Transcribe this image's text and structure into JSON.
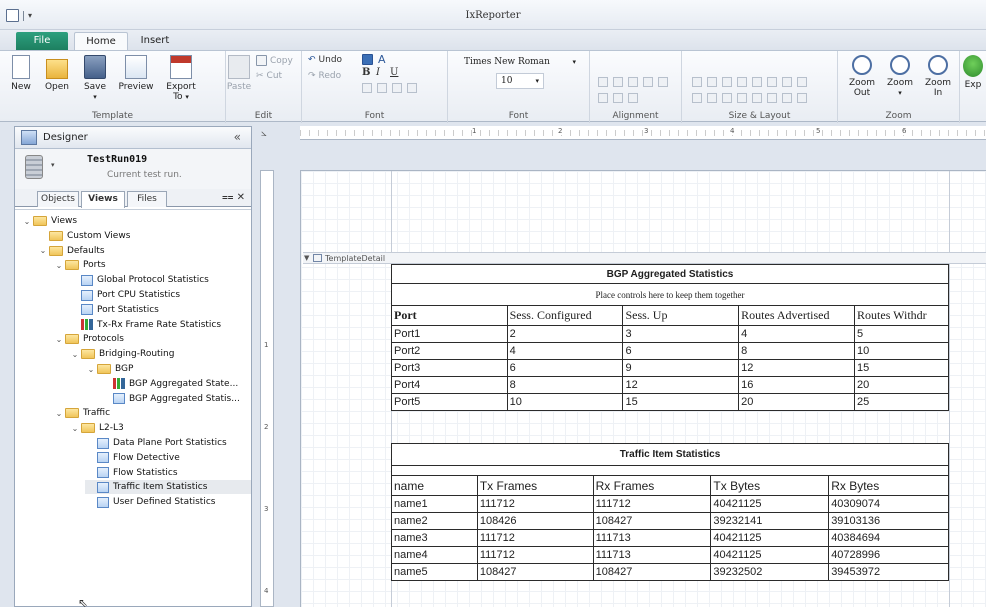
{
  "window": {
    "title": "IxReporter"
  },
  "tabs": {
    "file": "File",
    "home": "Home",
    "insert": "Insert"
  },
  "ribbon": {
    "template": {
      "label": "Template",
      "new": "New",
      "open": "Open",
      "save": "Save",
      "preview": "Preview",
      "export": "Export",
      "export_sub": "To"
    },
    "edit": {
      "label": "Edit",
      "paste": "Paste",
      "copy": "Copy",
      "cut": "Cut",
      "undo": "Undo",
      "redo": "Redo"
    },
    "font_group": {
      "label": "Font",
      "family": "Times New Roman",
      "size": "10"
    },
    "font_label2": "Font",
    "alignment": {
      "label": "Alignment"
    },
    "size_layout": {
      "label": "Size & Layout"
    },
    "zoom": {
      "label": "Zoom",
      "zoom_out": "Zoom Out",
      "zoom": "Zoom",
      "zoom_in": "Zoom In",
      "export_short": "Exp"
    }
  },
  "panel": {
    "title": "Designer",
    "collapse": "«",
    "run_name": "TestRun019",
    "run_sub": "Current test run.",
    "tabs": [
      "Objects",
      "Views",
      "Files"
    ],
    "tree": [
      {
        "label": "Views",
        "depth": 0,
        "type": "folder",
        "chev": "⌄"
      },
      {
        "label": "Custom Views",
        "depth": 1,
        "type": "folder",
        "chev": ""
      },
      {
        "label": "Defaults",
        "depth": 1,
        "type": "folder",
        "chev": "⌄"
      },
      {
        "label": "Ports",
        "depth": 2,
        "type": "folder",
        "chev": "⌄"
      },
      {
        "label": "Global Protocol Statistics",
        "depth": 3,
        "type": "table",
        "chev": ""
      },
      {
        "label": "Port CPU Statistics",
        "depth": 3,
        "type": "table",
        "chev": ""
      },
      {
        "label": "Port Statistics",
        "depth": 3,
        "type": "table",
        "chev": ""
      },
      {
        "label": "Tx-Rx Frame Rate Statistics",
        "depth": 3,
        "type": "chart",
        "chev": ""
      },
      {
        "label": "Protocols",
        "depth": 2,
        "type": "folder",
        "chev": "⌄"
      },
      {
        "label": "Bridging-Routing",
        "depth": 3,
        "type": "folder",
        "chev": "⌄"
      },
      {
        "label": "BGP",
        "depth": 4,
        "type": "folder",
        "chev": "⌄"
      },
      {
        "label": "BGP Aggregated State...",
        "depth": 5,
        "type": "chart",
        "chev": ""
      },
      {
        "label": "BGP Aggregated Statis...",
        "depth": 5,
        "type": "table",
        "chev": ""
      },
      {
        "label": "Traffic",
        "depth": 2,
        "type": "folder",
        "chev": "⌄"
      },
      {
        "label": "L2-L3",
        "depth": 3,
        "type": "folder",
        "chev": "⌄"
      },
      {
        "label": "Data Plane Port Statistics",
        "depth": 4,
        "type": "table",
        "chev": ""
      },
      {
        "label": "Flow Detective",
        "depth": 4,
        "type": "table",
        "chev": ""
      },
      {
        "label": "Flow Statistics",
        "depth": 4,
        "type": "table",
        "chev": ""
      },
      {
        "label": "Traffic Item Statistics",
        "depth": 4,
        "type": "table",
        "chev": "",
        "selected": true
      },
      {
        "label": "User Defined Statistics",
        "depth": 4,
        "type": "table",
        "chev": ""
      }
    ]
  },
  "designer": {
    "band_label": "TemplateDetail",
    "ruler_marks": [
      "1",
      "2",
      "3",
      "4",
      "5",
      "6"
    ],
    "ruler_left_marks": [
      "1",
      "2",
      "3",
      "4"
    ]
  },
  "report": {
    "bgp": {
      "title": "BGP Aggregated Statistics",
      "subtitle": "Place controls here to keep them together",
      "headers": [
        "Port",
        "Sess. Configured",
        "Sess. Up",
        "Routes Advertised",
        "Routes Withdr"
      ],
      "rows": [
        [
          "Port1",
          "2",
          "3",
          "4",
          "5"
        ],
        [
          "Port2",
          "4",
          "6",
          "8",
          "10"
        ],
        [
          "Port3",
          "6",
          "9",
          "12",
          "15"
        ],
        [
          "Port4",
          "8",
          "12",
          "16",
          "20"
        ],
        [
          "Port5",
          "10",
          "15",
          "20",
          "25"
        ]
      ]
    },
    "traffic": {
      "title": "Traffic Item Statistics",
      "headers": [
        "name",
        "Tx Frames",
        "Rx Frames",
        "Tx Bytes",
        "Rx Bytes"
      ],
      "rows": [
        [
          "name1",
          "111712",
          "111712",
          "40421125",
          "40309074"
        ],
        [
          "name2",
          "108426",
          "108427",
          "39232141",
          "39103136"
        ],
        [
          "name3",
          "111712",
          "111713",
          "40421125",
          "40384694"
        ],
        [
          "name4",
          "111712",
          "111713",
          "40421125",
          "40728996"
        ],
        [
          "name5",
          "108427",
          "108427",
          "39232502",
          "39453972"
        ]
      ]
    }
  }
}
